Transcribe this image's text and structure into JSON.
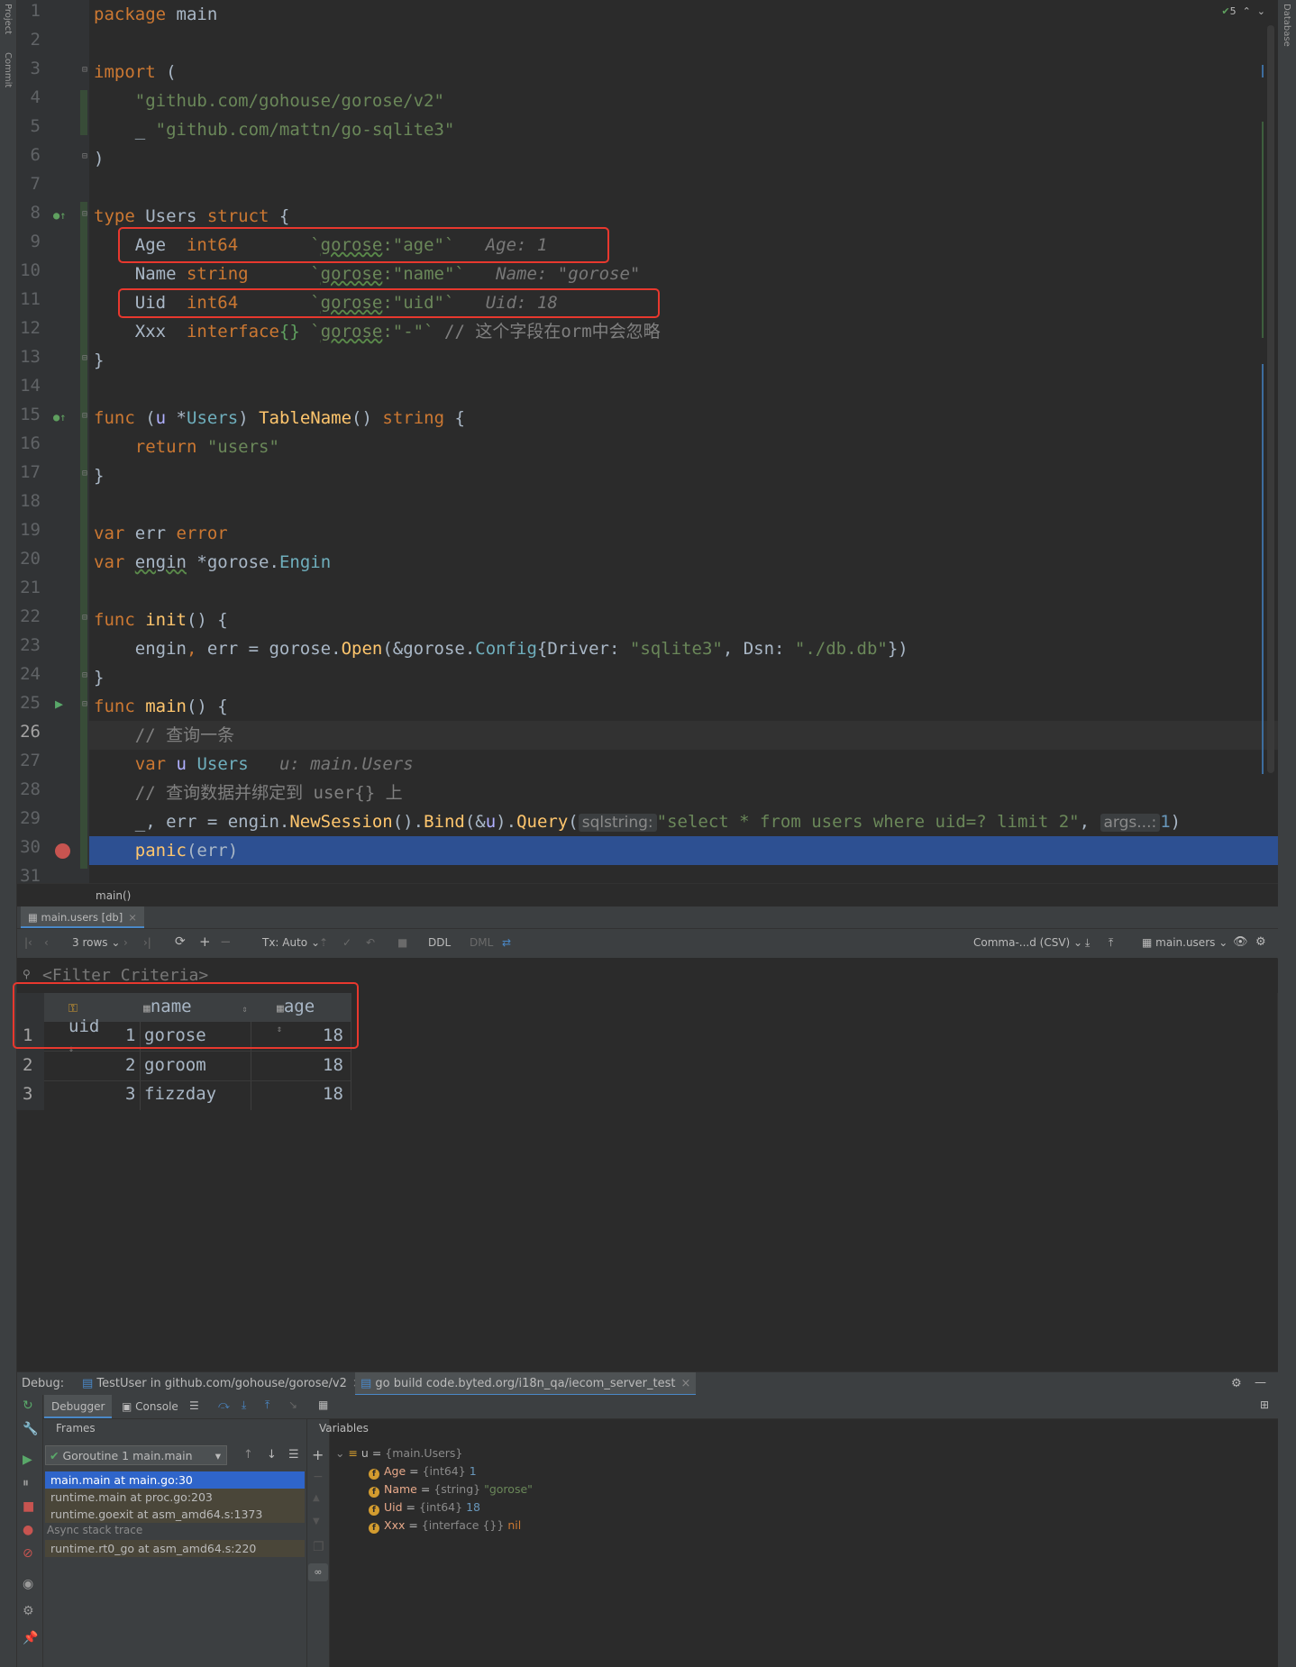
{
  "sidebar": {
    "left": [
      "Project",
      "Commit"
    ],
    "right": "Database"
  },
  "editor": {
    "inspections": "5",
    "lines": [
      {
        "n": "1"
      },
      {
        "n": "2"
      },
      {
        "n": "3"
      },
      {
        "n": "4"
      },
      {
        "n": "5"
      },
      {
        "n": "6"
      },
      {
        "n": "7"
      },
      {
        "n": "8"
      },
      {
        "n": "9"
      },
      {
        "n": "10"
      },
      {
        "n": "11"
      },
      {
        "n": "12"
      },
      {
        "n": "13"
      },
      {
        "n": "14"
      },
      {
        "n": "15"
      },
      {
        "n": "16"
      },
      {
        "n": "17"
      },
      {
        "n": "18"
      },
      {
        "n": "19"
      },
      {
        "n": "20"
      },
      {
        "n": "21"
      },
      {
        "n": "22"
      },
      {
        "n": "23"
      },
      {
        "n": "24"
      },
      {
        "n": "25"
      },
      {
        "n": "26"
      },
      {
        "n": "27"
      },
      {
        "n": "28"
      },
      {
        "n": "29"
      },
      {
        "n": "30"
      },
      {
        "n": "31"
      }
    ],
    "code": {
      "l1": [
        "package",
        " main"
      ],
      "l3": [
        "import",
        " ("
      ],
      "l4": "    \"github.com/gohouse/gorose/v2\"",
      "l5": [
        "    _ ",
        "\"github.com/mattn/go-sqlite3\""
      ],
      "l6": ")",
      "l8": [
        "type",
        " Users ",
        "struct",
        " {"
      ],
      "l9": [
        "    Age  ",
        "int64",
        "       `",
        "gorose",
        ":",
        "\"age\"",
        "`",
        "   Age: 1"
      ],
      "l10": [
        "    Name ",
        "string",
        "      `",
        "gorose",
        ":",
        "\"name\"",
        "`",
        "   Name: \"gorose\""
      ],
      "l11": [
        "    Uid  ",
        "int64",
        "       `",
        "gorose",
        ":",
        "\"uid\"",
        "`",
        "   Uid: 18"
      ],
      "l12": [
        "    Xxx  ",
        "interface",
        "{}",
        " `",
        "gorose",
        ":",
        "\"-\"",
        "`",
        " // 这个字段在orm中会忽略"
      ],
      "l13": "}",
      "l15": [
        "func",
        " (",
        "u",
        " *",
        "Users",
        ") ",
        "TableName",
        "() ",
        "string",
        " {"
      ],
      "l16": [
        "    ",
        "return",
        " \"users\""
      ],
      "l17": "}",
      "l19": [
        "var",
        " err ",
        "error"
      ],
      "l20": [
        "var",
        " ",
        "engin",
        " *gorose.",
        "Engin"
      ],
      "l22": [
        "func",
        " ",
        "init",
        "() {"
      ],
      "l23": [
        "    engin",
        ",",
        " err = gorose.",
        "Open",
        "(&gorose.",
        "Config",
        "{Driver: ",
        "\"sqlite3\"",
        ", Dsn: ",
        "\"./db.db\"",
        "})"
      ],
      "l24": "}",
      "l25": [
        "func",
        " ",
        "main",
        "() {"
      ],
      "l26": "    // 查询一条",
      "l27": [
        "    ",
        "var",
        " ",
        "u",
        " ",
        "Users",
        "   u: main.Users"
      ],
      "l28": "    // 查询数据并绑定到 user{} 上",
      "l29": [
        "    _, err = engin.",
        "NewSession",
        "().",
        "Bind",
        "(&",
        "u",
        ").",
        "Query",
        "(",
        "sqlstring:",
        "\"select * from users where uid=? limit 2\"",
        ", ",
        "args...:",
        "1",
        ")"
      ],
      "l30": [
        "    ",
        "panic",
        "(err)"
      ],
      "breadcrumb": "main()"
    }
  },
  "db": {
    "tab": "main.users [db]",
    "toolbar": {
      "rows": "3 rows",
      "tx": "Tx: Auto",
      "ddl": "DDL",
      "dml": "DML",
      "export_format": "Comma-...d (CSV)",
      "table": "main.users"
    },
    "filter_placeholder": "<Filter Criteria>",
    "columns": [
      "uid",
      "name",
      "age"
    ],
    "rows": [
      {
        "n": "1",
        "uid": "1",
        "name": "gorose",
        "age": "18"
      },
      {
        "n": "2",
        "uid": "2",
        "name": "goroom",
        "age": "18"
      },
      {
        "n": "3",
        "uid": "3",
        "name": "fizzday",
        "age": "18"
      }
    ]
  },
  "debug": {
    "label": "Debug:",
    "tabs": [
      "TestUser in github.com/gohouse/gorose/v2",
      "go build code.byted.org/i18n_qa/iecom_server_test"
    ],
    "subtabs": [
      "Debugger",
      "Console"
    ],
    "frames_label": "Frames",
    "variables_label": "Variables",
    "goroutine": "Goroutine 1 main.main",
    "frames": [
      "main.main at main.go:30",
      "runtime.main at proc.go:203",
      "runtime.goexit at asm_amd64.s:1373"
    ],
    "async_label": "Async stack trace",
    "async_frames": [
      "runtime.rt0_go at asm_amd64.s:220"
    ],
    "variables": {
      "root": {
        "name": "u",
        "value": "{main.Users}"
      },
      "fields": [
        {
          "name": "Age",
          "type": "{int64}",
          "value": "1"
        },
        {
          "name": "Name",
          "type": "{string}",
          "value": "\"gorose\""
        },
        {
          "name": "Uid",
          "type": "{int64}",
          "value": "18"
        },
        {
          "name": "Xxx",
          "type": "{interface {}}",
          "value": "nil"
        }
      ]
    }
  },
  "colors": {
    "accent": "#2f65ca",
    "highlight_box": "#e8382e",
    "breakpoint": "#c75450"
  }
}
